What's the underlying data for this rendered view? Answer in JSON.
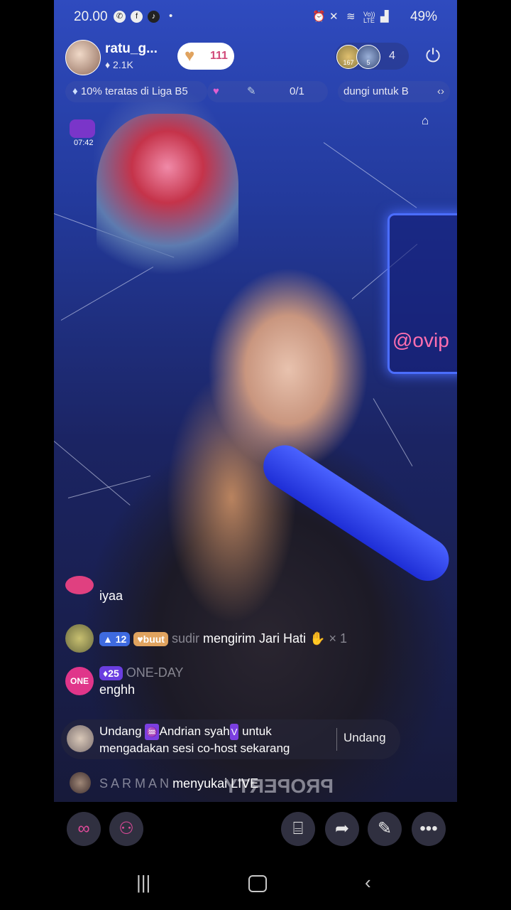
{
  "status_bar": {
    "time": "20.00",
    "app_icons": [
      "whatsapp-icon",
      "facebook-icon",
      "tiktok-icon"
    ],
    "battery": "49%",
    "network_label": "Vo)) LTE"
  },
  "host": {
    "name": "ratu_g...",
    "likes": "♦ 2.1K",
    "follow_count": "111"
  },
  "viewers": {
    "avatar_1_label": "167",
    "avatar_2_label": "5",
    "count": "4"
  },
  "info_bar": {
    "league": "10% teratas di Liga B5",
    "goal": "0/1",
    "ticker": "dungi untuk B"
  },
  "gift_timer": "07:42",
  "comments": [
    {
      "text": "iyaa"
    },
    {
      "level": "12",
      "fan_badge": "buut",
      "user": "sudir",
      "message": "mengirim Jari Hati",
      "multiplier": "× 1"
    },
    {
      "level": "25",
      "avatar_label": "ONE",
      "user": "ONE-DAY",
      "message": "enghh"
    }
  ],
  "invite": {
    "prefix": "Undang",
    "name": "Andrian syah",
    "suffix": "untuk",
    "line2": "mengadakan sesi co-host sekarang",
    "button": "Undang"
  },
  "like_event": {
    "user": "S A R M A N",
    "message": "menyukai LIVE"
  },
  "background_text": {
    "neon_sign": "@ovip",
    "shirt_text": "PROPERTY"
  },
  "colors": {
    "accent_purple": "#7b3fe0",
    "background_blue": "#233a9c",
    "follow_pink": "#d14a7a"
  }
}
